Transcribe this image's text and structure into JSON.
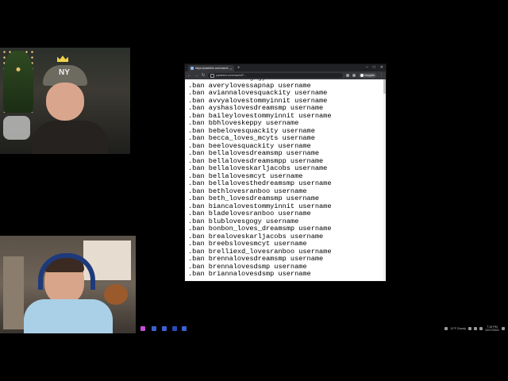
{
  "browser": {
    "tab_title": "https://pastebin.com/raw/dJF...",
    "url": "pastebin.com/raw/dJF...",
    "profile_label": "Incognito",
    "window_controls": [
      "–",
      "□",
      "✕"
    ]
  },
  "paste_lines": [
    ".ban avanilovesgogy username",
    ".ban averylovessapnap username",
    ".ban aviannalovesquackity username",
    ".ban avvyalovestommyinnit username",
    ".ban ayshaslovesdreamsmp username",
    ".ban baileylovestommyinnit username",
    ".ban bbhloveskeppy username",
    ".ban bebelovesquackity username",
    ".ban becca_loves_mcyts username",
    ".ban beelovesquackity username",
    ".ban bellalovesdreamsmp username",
    ".ban bellalovesdreamsmpp username",
    ".ban bellaloveskarljacobs username",
    ".ban bellalovesmcyt username",
    ".ban bellalovesthedreamsmp username",
    ".ban bethlovesranboo username",
    ".ban beth_lovesdreamsmp username",
    ".ban biancalovestommyinnit username",
    ".ban bladelovesranboo username",
    ".ban blublovesgogy username",
    ".ban bonbon_loves_dreamsmp username",
    ".ban brealoveskarljacobs username",
    ".ban breebslovesmcyt username",
    ".ban brelliexd_lovesranboo username",
    ".ban brennalovesdreamsmp username",
    ".ban brennalovesdsmp username",
    ".ban briannalovesdsmp username"
  ],
  "webcams": {
    "top_cap_logo": "NY"
  },
  "taskbar": {
    "weather": "11°F Cloudy",
    "time": "7:15 PM",
    "date": "12/17/2021",
    "pinned_icon_colors": [
      "#c44fd8",
      "#3a62d6",
      "#3a62d6",
      "#2a4bb8",
      "#3a62d6"
    ]
  }
}
